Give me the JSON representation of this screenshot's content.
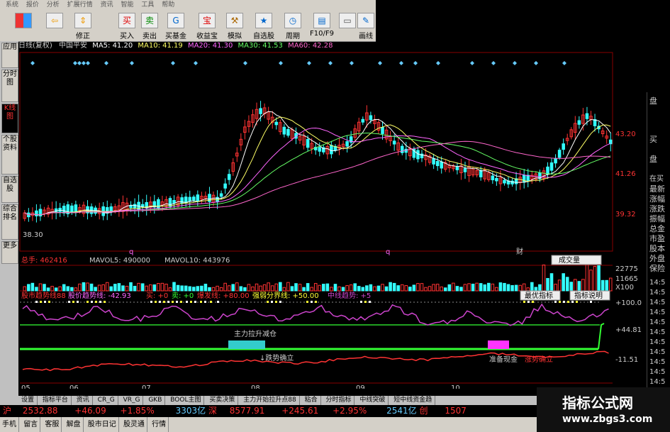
{
  "menu": [
    "系统",
    "报价",
    "分析",
    "扩展行情",
    "资讯",
    "智能",
    "工具",
    "帮助"
  ],
  "toolbar": [
    "",
    "",
    "修正",
    "买入",
    "卖出",
    "买基金",
    "收益宝",
    "模拟",
    "自选股",
    "周期",
    "F10/F9",
    "",
    "画线"
  ],
  "toolbar_icons": [
    "grid-icon",
    "back-arrow-icon",
    "updown-icon",
    "buy-icon",
    "sell-icon",
    "fund-icon",
    "treasure-icon",
    "hammer-icon",
    "star-icon",
    "clock-icon",
    "f10-icon",
    "display-icon",
    "pen-icon"
  ],
  "left_tabs": [
    "应用",
    "分时图",
    "K线图",
    "个股资料",
    "自选股",
    "综合排名",
    "更多"
  ],
  "title_row": {
    "label": "日线(复权)",
    "stock": "中国平安",
    "ma5": "MA5: 41.20",
    "ma10": "MA10: 41.19",
    "ma20": "MA20: 41.30",
    "ma30": "MA30: 41.53",
    "ma60": "MA60: 42.28"
  },
  "price_axis": [
    "43.20",
    "41.26",
    "39.32"
  ],
  "price_low_label": "38.30",
  "event_marks": [
    "q",
    "q",
    "财"
  ],
  "volume_row": {
    "label": "总手: 462416",
    "mavol5": "MAVOL5: 490000",
    "mavol10": "MAVOL10: 443976",
    "dropdown": "成交量"
  },
  "volume_axis": [
    "22775",
    "11665",
    "X100"
  ],
  "indicator_row": {
    "items": [
      "股市趋势线88",
      "股价趋势线: -42.93",
      "买: +0",
      "卖: +0",
      "爆发线: +80.00",
      "强弱分界线: +50.00",
      "中线趋势: +5"
    ],
    "btn_best": "最优指标",
    "btn_explain": "指标说明"
  },
  "indicator_axis": [
    "+100.0",
    "+44.81",
    "-11.51"
  ],
  "annotations": [
    "主力拉升减仓",
    "↓跌势确立",
    "准备现金",
    "涨势确立"
  ],
  "date_axis": [
    "05",
    "06",
    "07",
    "08",
    "09",
    "10"
  ],
  "right_panel": [
    "盘",
    "买",
    "盘",
    "在买",
    "最新",
    "涨幅",
    "涨跌",
    "振幅",
    "总金",
    "市盈",
    "股本",
    "外盘",
    "保险"
  ],
  "right_times": [
    "14:5",
    "14:5",
    "14:5",
    "14:5",
    "14:5",
    "14:5",
    "14:5",
    "14:5",
    "14:5",
    "14:5",
    "14:5"
  ],
  "bottom_tabs": [
    "设置",
    "指标平台",
    "资讯",
    "CR_G",
    "VR_G",
    "GKB",
    "BOOL主图",
    "买卖决策",
    "主力开始拉升点88",
    "粘合",
    "分时指标",
    "中线突破",
    "短中线资金趋"
  ],
  "ticker": {
    "sh": "沪",
    "sh_index": "2532.88",
    "sh_change": "+46.09",
    "sh_pct": "+1.85%",
    "sh_amount": "3303亿",
    "sz": "深",
    "sz_index": "8577.91",
    "sz_change": "+245.61",
    "sz_pct": "+2.95%",
    "sz_amount": "2541亿",
    "cy": "创",
    "cy_value": "1507"
  },
  "status_bar": [
    "手机",
    "留言",
    "客服",
    "解盘",
    "股市日记",
    "股灵通",
    "行情"
  ],
  "watermark": {
    "title": "指标公式网",
    "url": "www.zbgs3.com"
  },
  "colors": {
    "up": "#ff3333",
    "down": "#33ffff",
    "ma5": "#ffffff",
    "ma10": "#ffff66",
    "ma20": "#ff66ff",
    "ma30": "#66ff66",
    "ma60": "#ff66cc",
    "purple": "#cc44cc",
    "green": "#33ff33",
    "red": "#ff3333",
    "yellow": "#ffff33"
  }
}
